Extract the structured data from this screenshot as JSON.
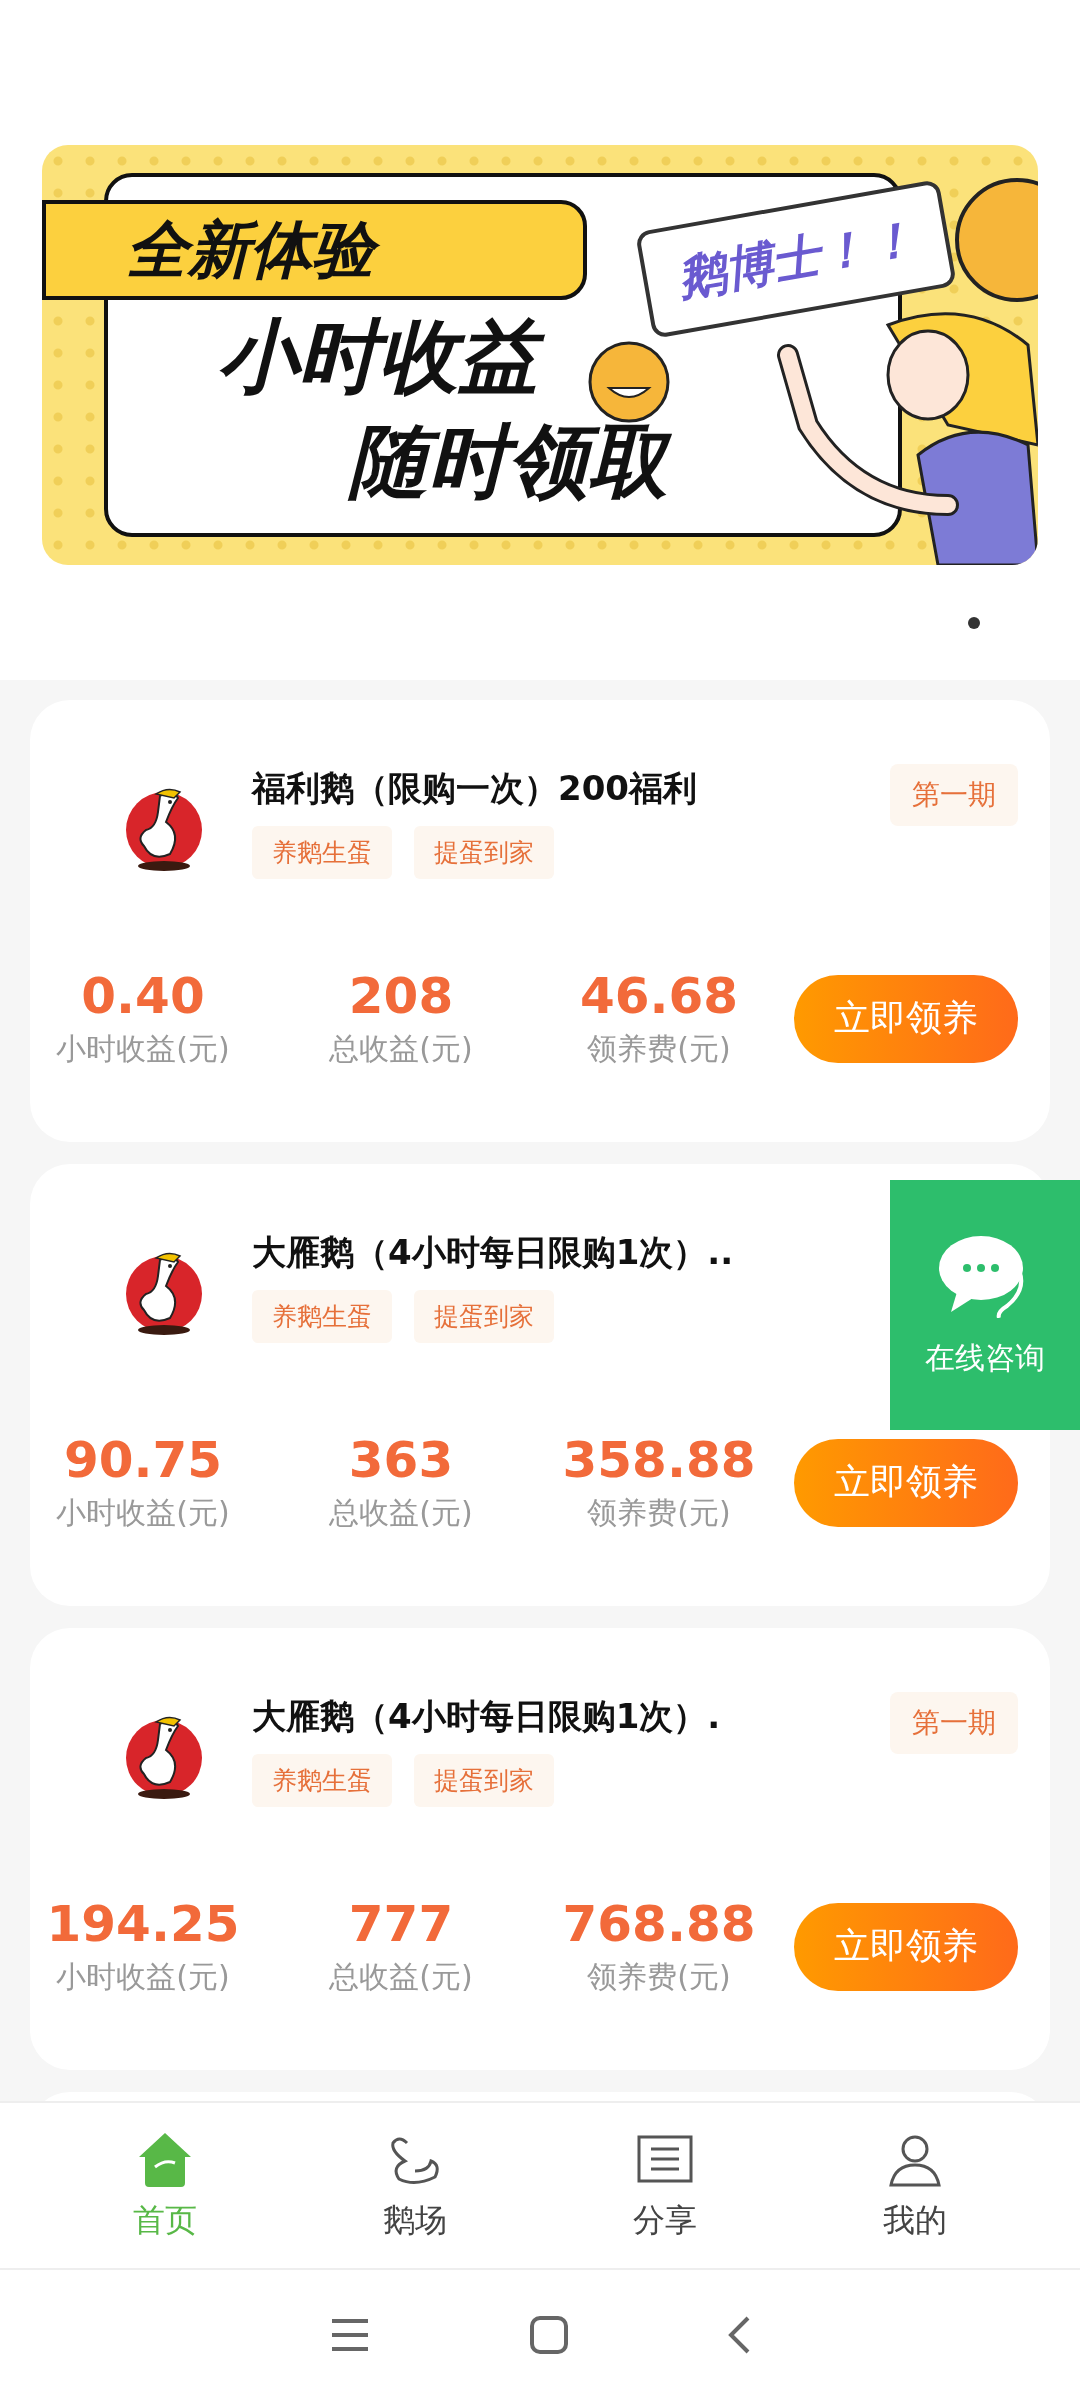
{
  "banner": {
    "label": "全新体验",
    "line_1": "小时收益",
    "line_2": "随时领取",
    "bubble": "鹅博士！！",
    "pages": [
      {
        "selected": true
      }
    ]
  },
  "products": [
    {
      "title": "福利鹅（限购一次）200福利",
      "period": "第一期",
      "tags": [
        "养鹅生蛋",
        "提蛋到家"
      ],
      "stats": [
        {
          "value": "0.40",
          "label": "小时收益(元)"
        },
        {
          "value": "208",
          "label": "总收益(元)"
        },
        {
          "value": "46.68",
          "label": "领养费(元)"
        }
      ],
      "button": "立即领养"
    },
    {
      "title": "大雁鹅（4小时每日限购1次）..",
      "tags": [
        "养鹅生蛋",
        "提蛋到家"
      ],
      "stats": [
        {
          "value": "90.75",
          "label": "小时收益(元)"
        },
        {
          "value": "363",
          "label": "总收益(元)"
        },
        {
          "value": "358.88",
          "label": "领养费(元)"
        }
      ],
      "button": "立即领养"
    },
    {
      "title": "大雁鹅（4小时每日限购1次）.",
      "period": "第一期",
      "tags": [
        "养鹅生蛋",
        "提蛋到家"
      ],
      "stats": [
        {
          "value": "194.25",
          "label": "小时收益(元)"
        },
        {
          "value": "777",
          "label": "总收益(元)"
        },
        {
          "value": "768.88",
          "label": "领养费(元)"
        }
      ],
      "button": "立即领养"
    }
  ],
  "consult": {
    "label": "在线咨询"
  },
  "tabs": [
    {
      "kind": "home",
      "label": "首页",
      "selected": true
    },
    {
      "kind": "goose",
      "label": "鹅场",
      "selected": false
    },
    {
      "kind": "share",
      "label": "分享",
      "selected": false
    },
    {
      "kind": "me",
      "label": "我的",
      "selected": false
    }
  ]
}
